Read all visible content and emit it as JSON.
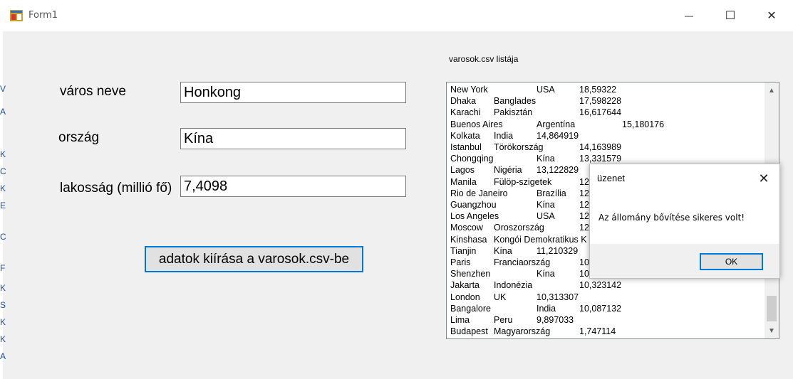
{
  "window": {
    "title": "Form1",
    "min_glyph": "—",
    "max_glyph": "☐",
    "close_glyph": "✕"
  },
  "form": {
    "city_label": "város neve",
    "city_value": "Honkong",
    "country_label": "ország",
    "country_value": "Kína",
    "population_label": "lakosság (millió fő)",
    "population_value": "7,4098",
    "write_button": "adatok kiírása a varosok.csv-be"
  },
  "list": {
    "title": "varosok.csv listája",
    "rows": [
      [
        "New York",
        "",
        "USA",
        "18,59322"
      ],
      [
        "Dhaka",
        "Banglades",
        "",
        "17,598228"
      ],
      [
        "Karachi",
        "Pakisztán",
        "",
        "16,617644"
      ],
      [
        "Buenos Aires",
        "",
        "Argentína",
        "15,180176"
      ],
      [
        "Kolkata",
        "India",
        "14,864919",
        ""
      ],
      [
        "Istanbul",
        "Törökország",
        "",
        "14,163989"
      ],
      [
        "Chongqing",
        "",
        "Kína",
        "13,331579"
      ],
      [
        "Lagos",
        "Nigéria",
        "13,122829",
        ""
      ],
      [
        "Manila",
        "Fülöp-szigetek",
        "",
        "12"
      ],
      [
        "Rio de Janeiro",
        "",
        "Brazília",
        "12"
      ],
      [
        "Guangzhou",
        "",
        "Kína",
        "12"
      ],
      [
        "Los Angeles",
        "",
        "USA",
        "12"
      ],
      [
        "Moscow",
        "Oroszország",
        "",
        "12"
      ],
      [
        "Kinshasa",
        "Kongói Demokratikus K",
        "",
        ""
      ],
      [
        "Tianjin",
        "Kína",
        "11,210329",
        ""
      ],
      [
        "Paris",
        "Franciaország",
        "",
        "10"
      ],
      [
        "Shenzhen",
        "",
        "Kína",
        "10"
      ],
      [
        "Jakarta",
        "Indonézia",
        "",
        "10,323142"
      ],
      [
        "London",
        "UK",
        "10,313307",
        ""
      ],
      [
        "Bangalore",
        "",
        "India",
        "10,087132"
      ],
      [
        "Lima",
        "Peru",
        "9,897033",
        ""
      ],
      [
        "Budapest",
        "Magyarország",
        "",
        "1,747114"
      ]
    ]
  },
  "dialog": {
    "title": "üzenet",
    "close_glyph": "✕",
    "message": "Az állomány bővítése sikeres volt!",
    "ok": "OK"
  },
  "scroll": {
    "up": "▲",
    "down": "▼"
  },
  "background_fragments": [
    "V",
    "A",
    "K",
    "C",
    "K",
    "E",
    "C",
    "F",
    "K",
    "S",
    "K",
    "K",
    "A"
  ]
}
